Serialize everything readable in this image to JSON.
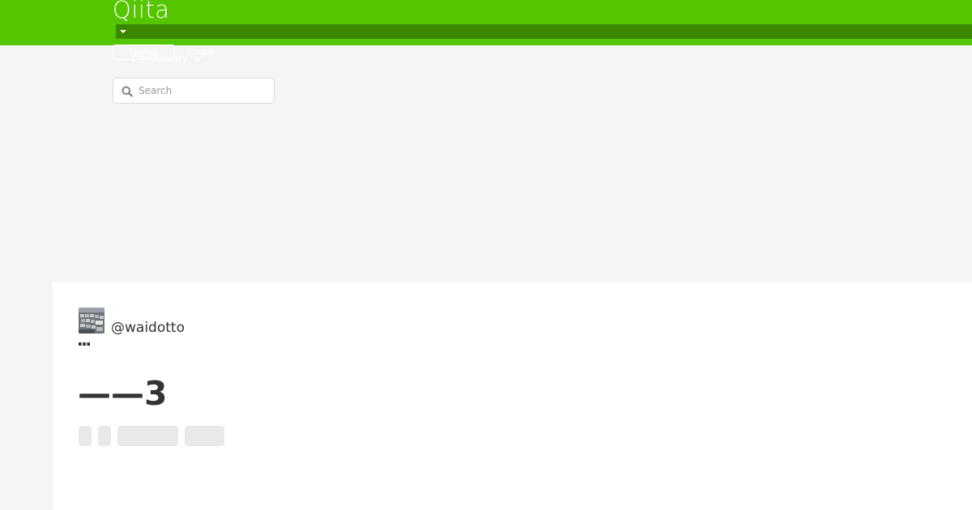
{
  "header": {
    "logo": "Qiita",
    "signup_label": "Signup",
    "login_label": "Login",
    "community_label": "Community",
    "search": {
      "placeholder": "Search",
      "value": ""
    }
  },
  "article": {
    "author": "@waidotto",
    "title": "——3",
    "tags_loading": 4
  },
  "colors": {
    "brand": "#55c500",
    "brand_dark": "#3a8800",
    "page_bg": "#f5f5f5",
    "skeleton": "#e9e9e9"
  },
  "icons": [
    "chevron-down-icon",
    "search-icon",
    "avatar",
    "more-icon"
  ]
}
